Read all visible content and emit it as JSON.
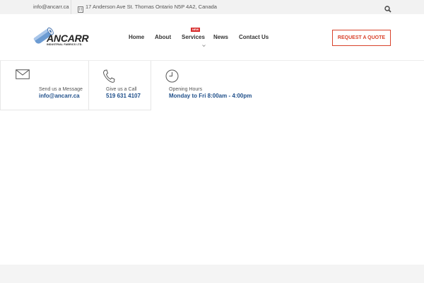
{
  "topbar": {
    "email": "info@ancarr.ca",
    "address": "17 Anderson Ave St. Thomas Ontario N5P 4A2, Canada"
  },
  "logo": {
    "brand": "ANCARR",
    "tagline": "INDUSTRIAL FABRICS LTD."
  },
  "nav": {
    "items": [
      {
        "label": "Home"
      },
      {
        "label": "About"
      },
      {
        "label": "Services",
        "badge": "NEW"
      },
      {
        "label": "News"
      },
      {
        "label": "Contact Us"
      }
    ]
  },
  "cta": {
    "label": "REQUEST A QUOTE"
  },
  "info": {
    "message": {
      "label": "Send us a Message",
      "value": "info@ancarr.ca",
      "icon": "envelope-icon"
    },
    "call": {
      "label": "Give us a Call",
      "value": "519 631 4107",
      "icon": "phone-icon"
    },
    "hours": {
      "label": "Opening Hours",
      "value": "Monday to Fri 8:00am - 4:00pm",
      "icon": "clock-icon"
    }
  },
  "colors": {
    "accent": "#d9422b",
    "link_blue": "#1f4f8a",
    "badge": "#d82e2e"
  }
}
